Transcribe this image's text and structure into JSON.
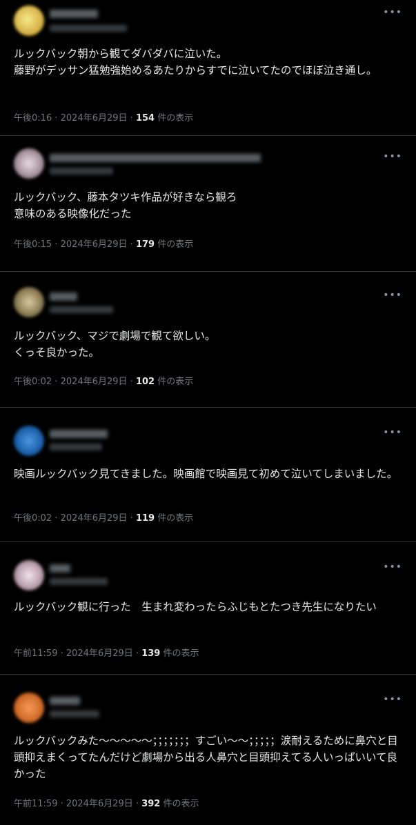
{
  "posts": [
    {
      "avatar_color": "#d9c25a",
      "text": "ルックバック朝から観てダバダバに泣いた。\n藤野がデッサン猛勉強始めるあたりからすでに泣いてたのでほぼ泣き通し。",
      "time": "午後0:16",
      "date": "2024年6月29日",
      "views": "154",
      "views_label": "件の表示"
    },
    {
      "avatar_color": "#b7a8b0",
      "text": "ルックバック、藤本タツキ作品が好きなら観ろ\n意味のある映像化だった",
      "time": "午後0:15",
      "date": "2024年6月29日",
      "views": "179",
      "views_label": "件の表示"
    },
    {
      "avatar_color": "#8d7e5e",
      "text": "ルックバック、マジで劇場で観て欲しい。\nくっそ良かった。",
      "time": "午後0:02",
      "date": "2024年6月29日",
      "views": "102",
      "views_label": "件の表示"
    },
    {
      "avatar_color": "#1f6fbf",
      "text": "映画ルックバック見てきました。映画館で映画見て初めて泣いてしまいました。",
      "time": "午後0:02",
      "date": "2024年6月29日",
      "views": "119",
      "views_label": "件の表示"
    },
    {
      "avatar_color": "#c9b4bd",
      "text": "ルックバック観に行った　生まれ変わったらふじもとたつき先生になりたい",
      "time": "午前11:59",
      "date": "2024年6月29日",
      "views": "139",
      "views_label": "件の表示"
    },
    {
      "avatar_color": "#d8743a",
      "text": "ルックバックみた〜〜〜〜〜；；；；；；；すごい〜〜；；；；；涙耐えるために鼻穴と目頭抑えまくってたんだけど劇場から出る人鼻穴と目頭抑えてる人いっぱいいて良かった",
      "time": "午前11:59",
      "date": "2024年6月29日",
      "views": "392",
      "views_label": "件の表示"
    }
  ],
  "more_icon": "more-icon",
  "separator": "·"
}
